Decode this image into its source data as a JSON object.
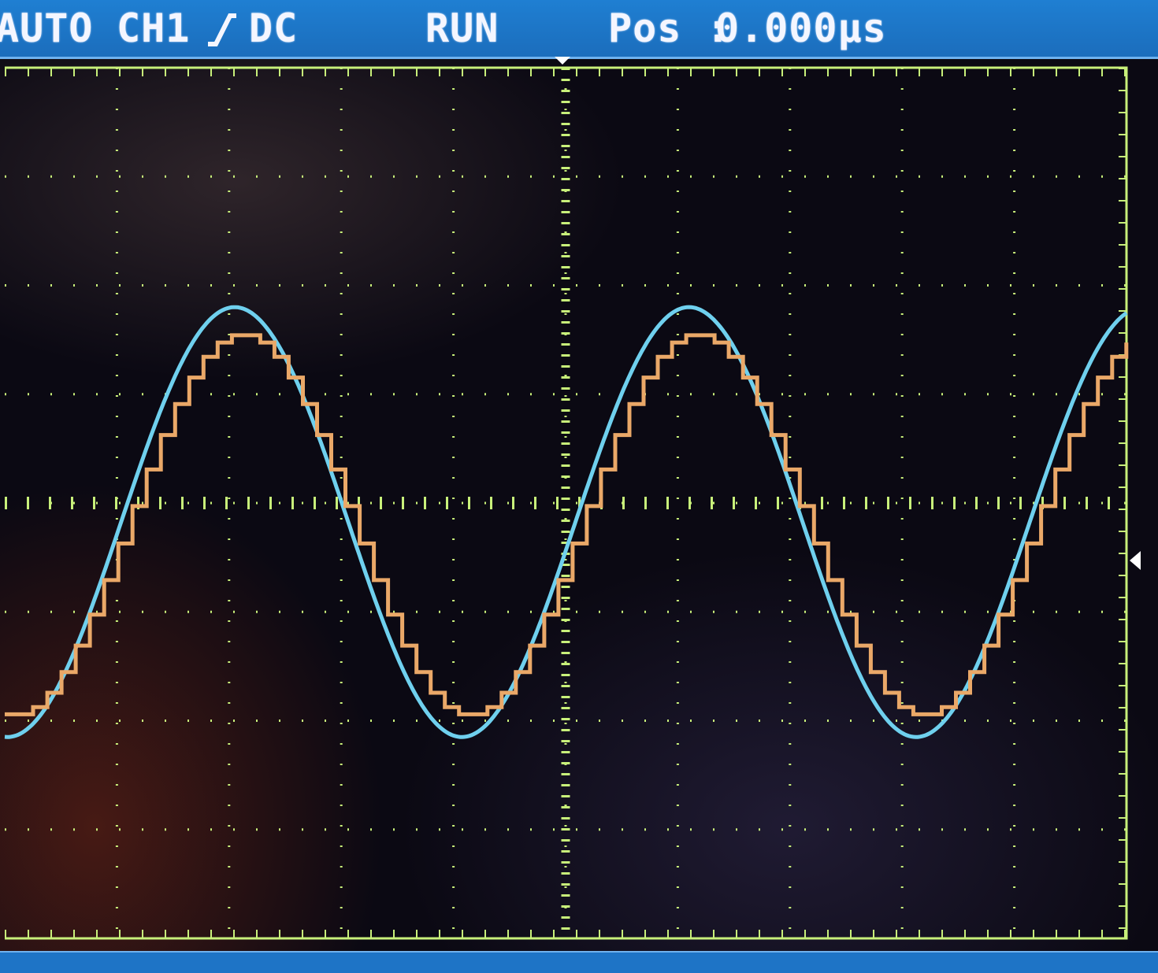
{
  "header": {
    "trigger_mode": "AUTO",
    "trigger_source": "CH1",
    "trigger_slope_icon": "rising-edge-icon",
    "coupling": "DC",
    "run_state": "RUN",
    "position_label": "Pos :",
    "position_value": "0.000µs"
  },
  "display": {
    "grid_divisions_x": 10,
    "grid_divisions_y": 8,
    "grid_color": "#c8f07a",
    "background_color": "#0b0913",
    "header_color": "#1f7fd2"
  },
  "chart_data": {
    "type": "line",
    "xlim": [
      0,
      10
    ],
    "ylim": [
      -4,
      4
    ],
    "series": [
      {
        "color": "#6fd0ee",
        "shape": "sine",
        "peak_div": 1.8,
        "trough_div": -2.15,
        "offset_div": -0.18,
        "period_div": 4.05,
        "first_peak_at_div": 2.05
      },
      {
        "color": "#eaa868",
        "shape": "staircase-sine",
        "peak_div": 1.55,
        "trough_div": -1.95,
        "offset_div": -0.2,
        "period_div": 4.05,
        "first_peak_at_div": 2.05,
        "steps_per_period": 32
      }
    ]
  }
}
